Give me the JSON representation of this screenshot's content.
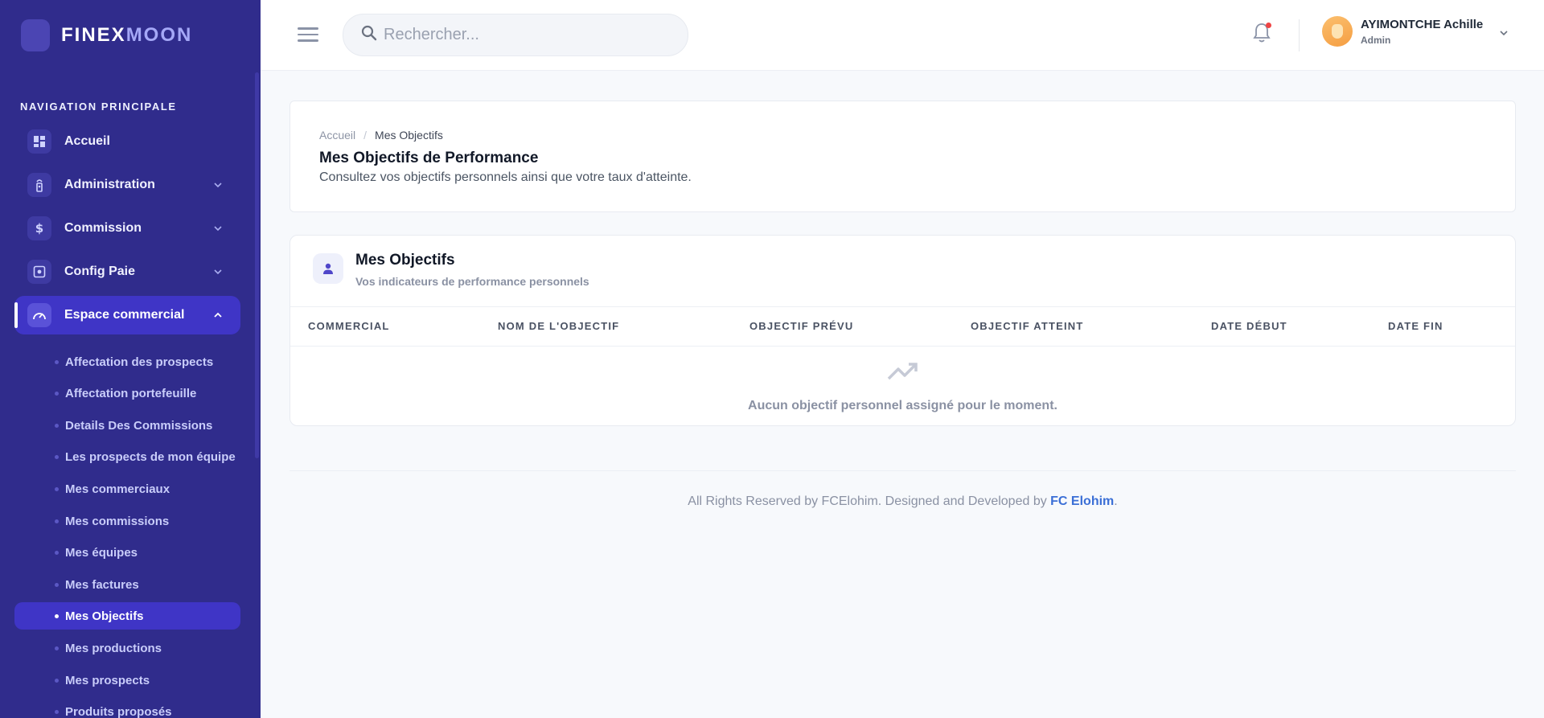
{
  "brand": {
    "name_a": "FINEX",
    "name_b": "MOON"
  },
  "sidebar": {
    "section_title": "NAVIGATION PRINCIPALE",
    "items": [
      {
        "label": "Accueil",
        "icon": "dashboard-icon"
      },
      {
        "label": "Administration",
        "icon": "tower-icon"
      },
      {
        "label": "Commission",
        "icon": "dollar-icon"
      },
      {
        "label": "Config Paie",
        "icon": "settings-box-icon"
      },
      {
        "label": "Espace commercial",
        "icon": "speedometer-icon",
        "expanded": true
      }
    ],
    "subitems": [
      {
        "label": "Affectation des prospects"
      },
      {
        "label": "Affectation portefeuille"
      },
      {
        "label": "Details Des Commissions"
      },
      {
        "label": "Les prospects de mon équipe"
      },
      {
        "label": "Mes commerciaux"
      },
      {
        "label": "Mes commissions"
      },
      {
        "label": "Mes équipes"
      },
      {
        "label": "Mes factures"
      },
      {
        "label": "Mes Objectifs",
        "active": true
      },
      {
        "label": "Mes productions"
      },
      {
        "label": "Mes prospects"
      },
      {
        "label": "Produits proposés"
      }
    ]
  },
  "header": {
    "search_placeholder": "Rechercher...",
    "user_name": "AYIMONTCHE Achille",
    "user_role": "Admin",
    "notification_dot_color": "#ef4444"
  },
  "page": {
    "breadcrumb_home": "Accueil",
    "breadcrumb_separator": "/",
    "breadcrumb_current": "Mes Objectifs",
    "title": "Mes Objectifs de Performance",
    "subtitle": "Consultez vos objectifs personnels ainsi que votre taux d'atteinte."
  },
  "objectives": {
    "title": "Mes Objectifs",
    "subtitle": "Vos indicateurs de performance personnels",
    "columns": [
      "COMMERCIAL",
      "NOM DE L'OBJECTIF",
      "OBJECTIF PRÉVU",
      "OBJECTIF ATTEINT",
      "DATE DÉBUT",
      "DATE FIN"
    ],
    "empty_message": "Aucun objectif personnel assigné pour le moment."
  },
  "footer": {
    "text": "All Rights Reserved by FCElohim. Designed and Developed by ",
    "link": "FC Elohim",
    "end": "."
  },
  "colors": {
    "sidebar_bg": "#302c8c",
    "active_bg": "#3f35c6",
    "link": "#3b6fd6"
  }
}
